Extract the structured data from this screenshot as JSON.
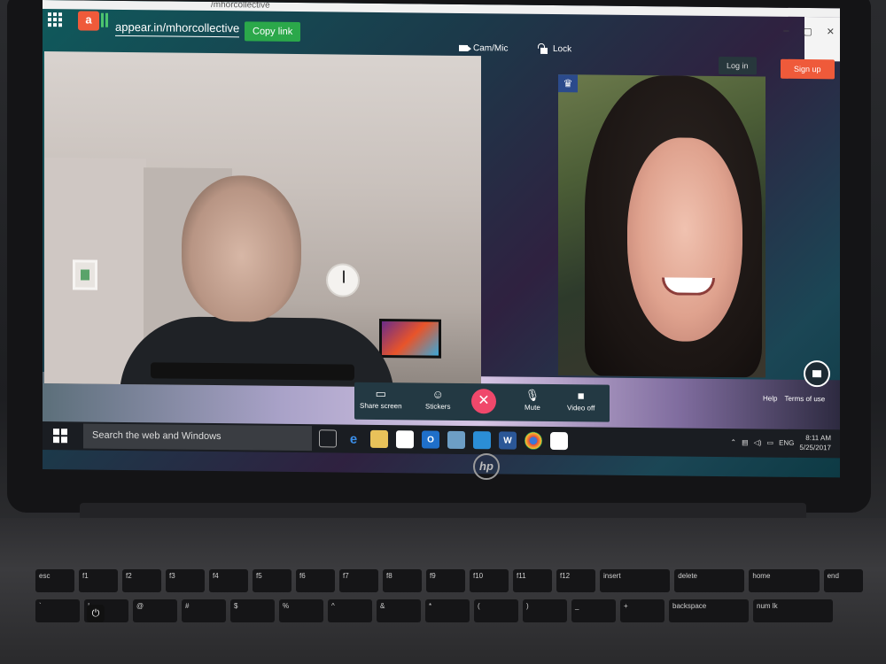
{
  "browser": {
    "url_fragment": "/mhorcollective",
    "window_controls": [
      "–",
      "▢",
      "✕"
    ]
  },
  "header": {
    "room_url": "appear.in/mhorcollective",
    "copy_link_label": "Copy link",
    "cam_mic_label": "Cam/Mic",
    "lock_label": "Lock",
    "login_label": "Log in",
    "signup_label": "Sign up"
  },
  "controls": {
    "share_screen_label": "Share screen",
    "stickers_label": "Stickers",
    "leave_glyph": "✕",
    "mute_label": "Mute",
    "video_off_label": "Video off"
  },
  "footer": {
    "help_label": "Help",
    "terms_label": "Terms of use"
  },
  "taskbar": {
    "search_placeholder": "Search the web and Windows",
    "language": "ENG",
    "time": "8:11 AM",
    "date": "5/25/2017"
  },
  "laptop": {
    "brand": "hp",
    "keys_row1": [
      "esc",
      "f1",
      "f2",
      "f3",
      "f4",
      "f5",
      "f6",
      "f7",
      "f8",
      "f9",
      "f10",
      "f11",
      "f12",
      "insert",
      "delete",
      "home",
      "end"
    ],
    "keys_row2": [
      "`",
      "!",
      "@",
      "#",
      "$",
      "%",
      "^",
      "&",
      "*",
      "(",
      ")",
      "_",
      "+",
      "backspace",
      "num lk"
    ]
  },
  "colors": {
    "accent_green": "#2ba84a",
    "signup_orange": "#ef5a3a",
    "leave_pink": "#f0486b"
  }
}
